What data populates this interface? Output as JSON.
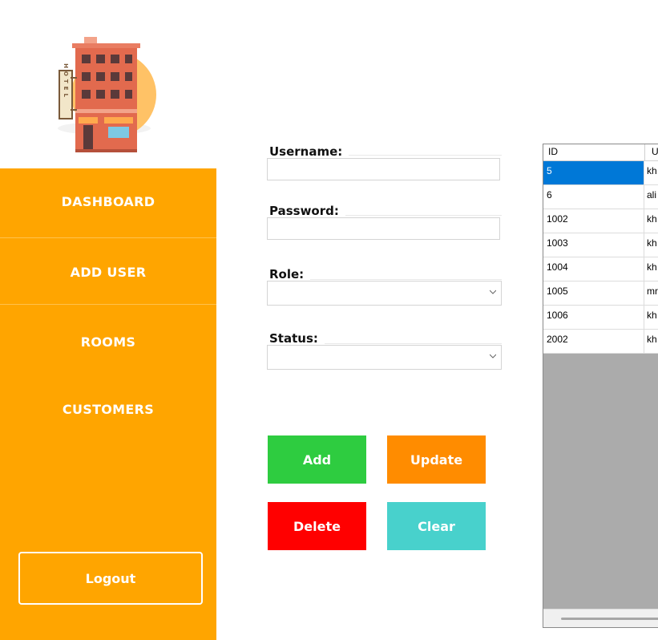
{
  "sidebar": {
    "logo_text": "HOTEL",
    "items": [
      {
        "label": "DASHBOARD"
      },
      {
        "label": "ADD USER"
      },
      {
        "label": "ROOMS"
      },
      {
        "label": "CUSTOMERS"
      }
    ],
    "logout_label": "Logout"
  },
  "form": {
    "username": {
      "label": "Username:",
      "value": ""
    },
    "password": {
      "label": "Password:",
      "value": ""
    },
    "role": {
      "label": "Role:",
      "selected": ""
    },
    "status": {
      "label": "Status:",
      "selected": ""
    }
  },
  "buttons": {
    "add": {
      "label": "Add",
      "color": "#2ecc40"
    },
    "update": {
      "label": "Update",
      "color": "#ff8c00"
    },
    "delete": {
      "label": "Delete",
      "color": "#ff0000"
    },
    "clear": {
      "label": "Clear",
      "color": "#48d1cc"
    }
  },
  "grid": {
    "columns": [
      "ID",
      "U"
    ],
    "rows": [
      {
        "id": "5",
        "user": "kh",
        "selected": true
      },
      {
        "id": "6",
        "user": "ali",
        "selected": false
      },
      {
        "id": "1002",
        "user": "kh",
        "selected": false
      },
      {
        "id": "1003",
        "user": "kh",
        "selected": false
      },
      {
        "id": "1004",
        "user": "kh",
        "selected": false
      },
      {
        "id": "1005",
        "user": "mr",
        "selected": false
      },
      {
        "id": "1006",
        "user": "kh",
        "selected": false
      },
      {
        "id": "2002",
        "user": "kh",
        "selected": false
      }
    ]
  },
  "colors": {
    "sidebar": "#ffa500",
    "selection": "#0078d7",
    "grid_background": "#ababab"
  }
}
